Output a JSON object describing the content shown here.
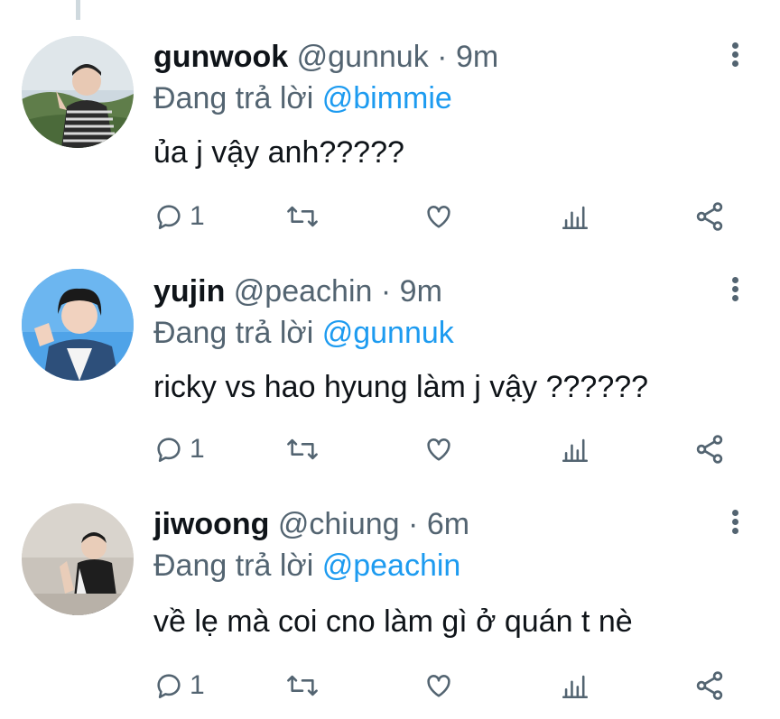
{
  "colors": {
    "text": "#0f1419",
    "muted": "#536471",
    "link": "#1d9bf0",
    "thread": "#cfd9de"
  },
  "tweets": [
    {
      "name": "gunwook",
      "handle": "@gunnuk",
      "separator": "·",
      "time": "9m",
      "replying_prefix": "Đang trả lời",
      "replying_to": "@bimmie",
      "text": "ủa j vậy anh?????",
      "reply_count": "1",
      "icons": [
        "reply-icon",
        "retweet-icon",
        "like-icon",
        "analytics-icon",
        "share-icon"
      ]
    },
    {
      "name": "yujin",
      "handle": "@peachin",
      "separator": "·",
      "time": "9m",
      "replying_prefix": "Đang trả lời",
      "replying_to": "@gunnuk",
      "text": "ricky vs hao hyung làm j vậy ??????",
      "reply_count": "1",
      "icons": [
        "reply-icon",
        "retweet-icon",
        "like-icon",
        "analytics-icon",
        "share-icon"
      ]
    },
    {
      "name": "jiwoong",
      "handle": "@chiung",
      "separator": "·",
      "time": "6m",
      "replying_prefix": "Đang trả lời",
      "replying_to": "@peachin",
      "text": "về lẹ mà coi cno làm gì ở quán t nè",
      "reply_count": "1",
      "icons": [
        "reply-icon",
        "retweet-icon",
        "like-icon",
        "analytics-icon",
        "share-icon"
      ]
    }
  ]
}
